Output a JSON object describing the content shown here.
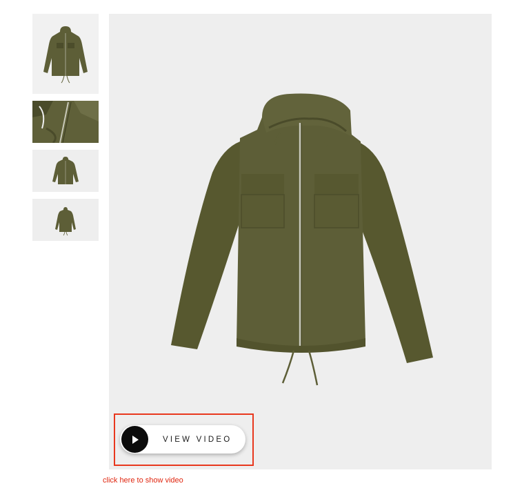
{
  "gallery": {
    "thumbnails": [
      {
        "icon": "jacket-front-thumbnail"
      },
      {
        "icon": "jacket-zipper-closeup-thumbnail"
      },
      {
        "icon": "jacket-front-small-thumbnail"
      },
      {
        "icon": "jacket-back-small-thumbnail"
      }
    ],
    "main_image_icon": "olive-hooded-jacket-image",
    "colors": {
      "jacket": "#5d5e37",
      "jacket_shadow": "#4c4d2b",
      "image_background": "#eeeeee"
    }
  },
  "video": {
    "button_label": "VIEW VIDEO",
    "play_icon": "play-icon",
    "caption": "click here to show video",
    "highlight_color": "#e8371d",
    "caption_color": "#e0260f"
  }
}
